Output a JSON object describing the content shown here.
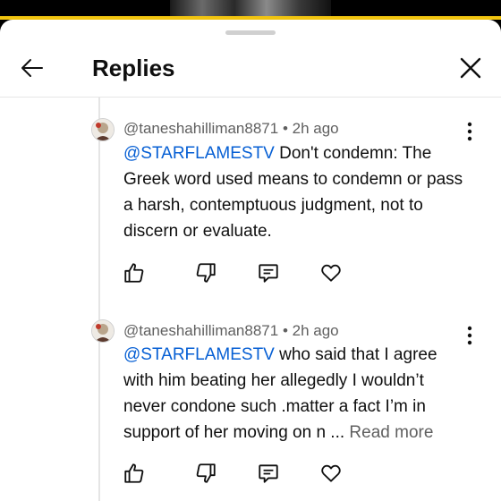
{
  "header": {
    "title": "Replies"
  },
  "comments": [
    {
      "author": "@taneshahilliman8871",
      "separator": "•",
      "time": "2h ago",
      "mention": "@STARFLAMESTV",
      "text": " Don't condemn: The Greek word used means to condemn or pass a harsh, contemptuous judgment, not to discern or evaluate."
    },
    {
      "author": "@taneshahilliman8871",
      "separator": "•",
      "time": "2h ago",
      "mention": "@STARFLAMESTV",
      "text": " who said that I agree with him beating her allegedly I wouldn’t never condone such .matter a fact I’m in support of her moving on n ... ",
      "read_more": "Read more"
    }
  ],
  "icons": {
    "back": "arrow-left-icon",
    "close": "close-icon",
    "more": "more-vertical-icon",
    "like": "thumbs-up-icon",
    "dislike": "thumbs-down-icon",
    "reply": "comment-icon",
    "heart": "heart-icon"
  },
  "colors": {
    "mention": "#065fd4",
    "meta": "#606060",
    "accent": "#f1c40f"
  }
}
